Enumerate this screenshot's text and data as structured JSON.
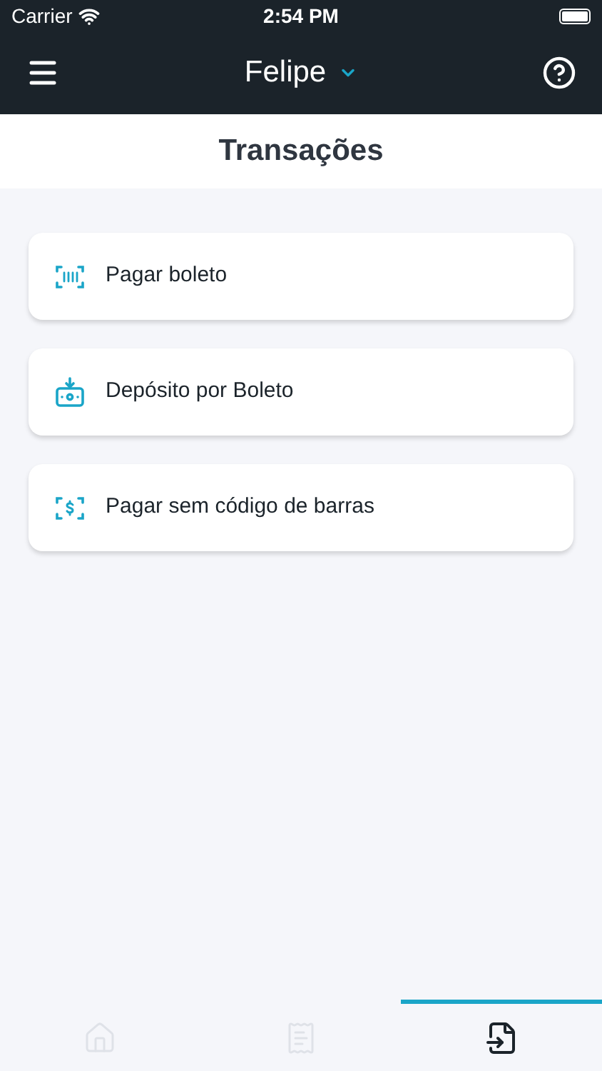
{
  "status_bar": {
    "carrier": "Carrier",
    "time": "2:54 PM"
  },
  "nav": {
    "account": "Felipe"
  },
  "header": {
    "title": "Transações"
  },
  "options": [
    {
      "kind": "barcode",
      "label": "Pagar boleto"
    },
    {
      "kind": "deposit",
      "label": "Depósito por Boleto"
    },
    {
      "kind": "money",
      "label": "Pagar sem código de barras"
    }
  ],
  "tab_bar": [
    {
      "kind": "home",
      "selected": false
    },
    {
      "kind": "receipt",
      "selected": false
    },
    {
      "kind": "transfer",
      "selected": true
    }
  ]
}
